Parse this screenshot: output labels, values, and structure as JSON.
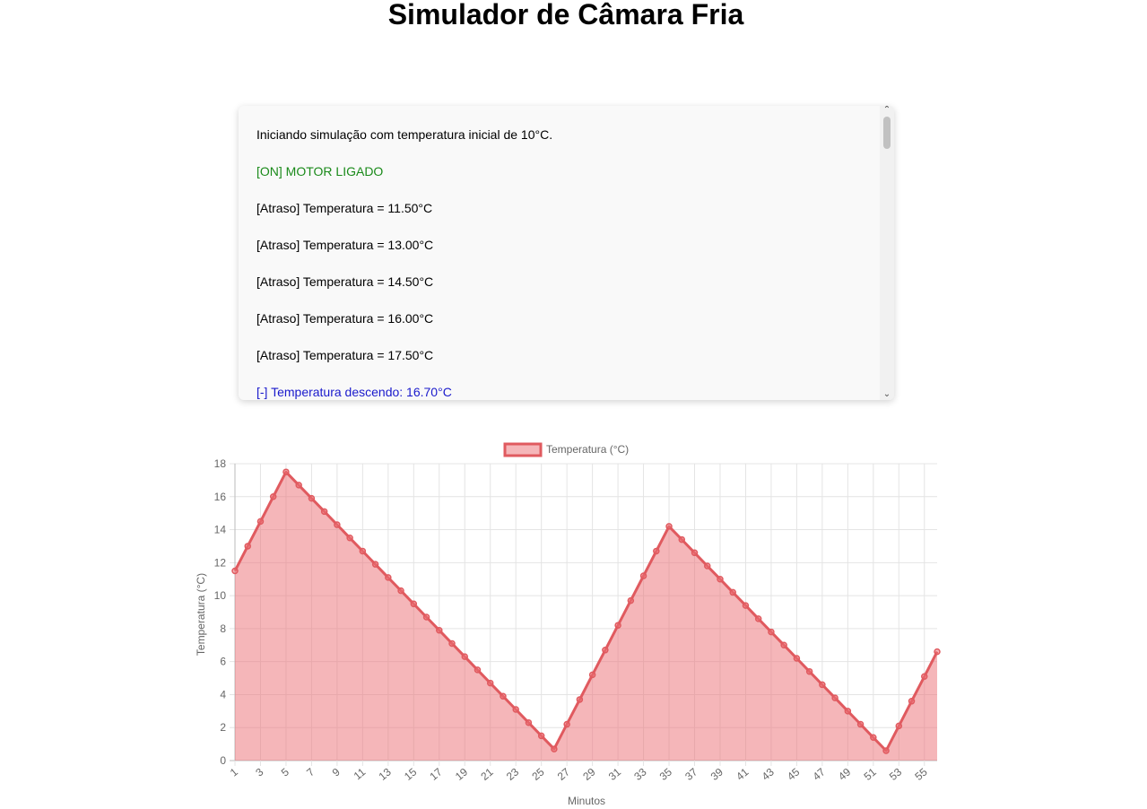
{
  "page": {
    "title": "Simulador de Câmara Fria"
  },
  "log": {
    "lines": [
      {
        "text": "Iniciando simulação com temperatura inicial de 10°C.",
        "color": "#000000"
      },
      {
        "text": "[ON] MOTOR LIGADO",
        "color": "#1a8a1a"
      },
      {
        "text": "[Atraso] Temperatura = 11.50°C",
        "color": "#000000"
      },
      {
        "text": "[Atraso] Temperatura = 13.00°C",
        "color": "#000000"
      },
      {
        "text": "[Atraso] Temperatura = 14.50°C",
        "color": "#000000"
      },
      {
        "text": "[Atraso] Temperatura = 16.00°C",
        "color": "#000000"
      },
      {
        "text": "[Atraso] Temperatura = 17.50°C",
        "color": "#000000"
      },
      {
        "text": "[-] Temperatura descendo: 16.70°C",
        "color": "#1a1acc"
      }
    ]
  },
  "chart_data": {
    "type": "area",
    "legend": "Temperatura (°C)",
    "legend_position": "top",
    "xlabel": "Minutos",
    "ylabel": "Temperatura (°C)",
    "ylim": [
      0,
      18
    ],
    "yticks": [
      0,
      2,
      4,
      6,
      8,
      10,
      12,
      14,
      16,
      18
    ],
    "grid": true,
    "x": [
      1,
      2,
      3,
      4,
      5,
      6,
      7,
      8,
      9,
      10,
      11,
      12,
      13,
      14,
      15,
      16,
      17,
      18,
      19,
      20,
      21,
      22,
      23,
      24,
      25,
      26,
      27,
      28,
      29,
      30,
      31,
      32,
      33,
      34,
      35,
      36,
      37,
      38,
      39,
      40,
      41,
      42,
      43,
      44,
      45,
      46,
      47,
      48,
      49,
      50,
      51,
      52,
      53,
      54,
      55,
      56
    ],
    "xtick_labels": [
      "1",
      "3",
      "5",
      "7",
      "9",
      "11",
      "13",
      "15",
      "17",
      "19",
      "21",
      "23",
      "25",
      "27",
      "29",
      "31",
      "33",
      "35",
      "37",
      "39",
      "41",
      "43",
      "45",
      "47",
      "49",
      "51",
      "53",
      "55"
    ],
    "series": [
      {
        "name": "Temperatura (°C)",
        "color": "#e05a5f",
        "fill": "rgba(235,110,115,0.5)",
        "values": [
          11.5,
          13.0,
          14.5,
          16.0,
          17.5,
          16.7,
          15.9,
          15.1,
          14.3,
          13.5,
          12.7,
          11.9,
          11.1,
          10.3,
          9.5,
          8.7,
          7.9,
          7.1,
          6.3,
          5.5,
          4.7,
          3.9,
          3.1,
          2.3,
          1.5,
          0.7,
          2.2,
          3.7,
          5.2,
          6.7,
          8.2,
          9.7,
          11.2,
          12.7,
          14.2,
          13.4,
          12.6,
          11.8,
          11.0,
          10.2,
          9.4,
          8.6,
          7.8,
          7.0,
          6.2,
          5.4,
          4.6,
          3.8,
          3.0,
          2.2,
          1.4,
          0.6,
          2.1,
          3.6,
          5.1,
          6.6
        ]
      }
    ]
  }
}
